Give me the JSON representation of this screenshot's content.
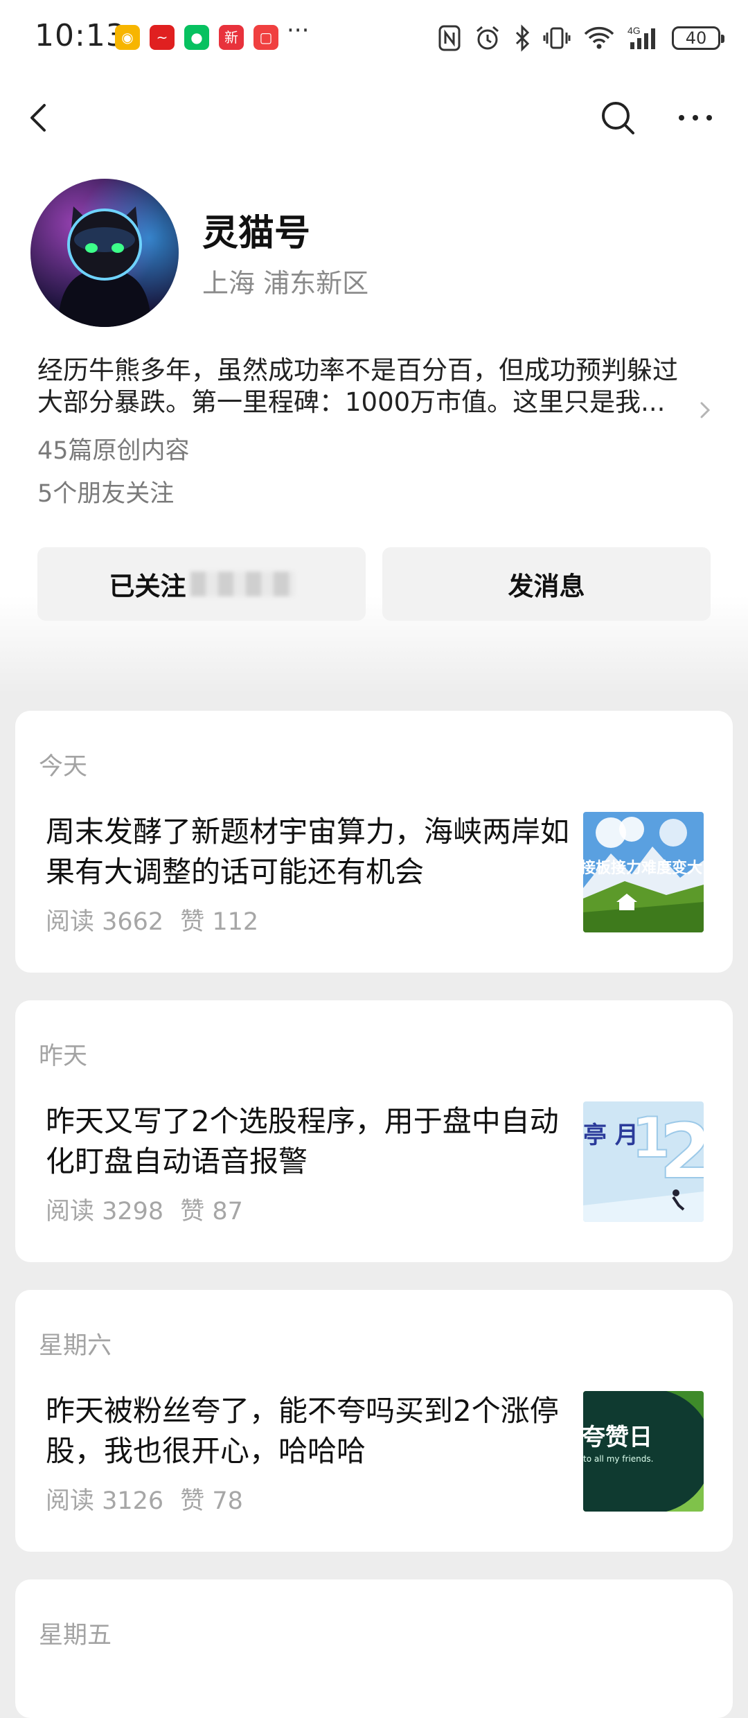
{
  "status_bar": {
    "time": "10:13",
    "app_icons": [
      {
        "icon": "weibo-icon",
        "color": "#f5a623"
      },
      {
        "icon": "finance-app-icon",
        "color": "#e02020"
      },
      {
        "icon": "wechat-icon",
        "color": "#07c160"
      },
      {
        "icon": "news-app-icon",
        "color": "#e8323c"
      },
      {
        "icon": "red-app-icon",
        "color": "#f04040"
      }
    ],
    "overflow": "···",
    "network": "4G",
    "battery": "40"
  },
  "profile": {
    "name": "灵猫号",
    "location": "上海 浦东新区",
    "bio_line1": "经历牛熊多年，虽然成功率不是百分百，但成功预判躲过",
    "bio_line2": "大部分暴跌。第一里程碑：1000万市值。这里只是我...",
    "articles_count": "45篇原创内容",
    "friends_following": "5个朋友关注"
  },
  "actions": {
    "follow_label": "已关注",
    "message_label": "发消息"
  },
  "articles": [
    {
      "day": "今天",
      "title": "周末发酵了新题材宇宙算力，海峡两岸如果有大调整的话可能还有机会",
      "reads": "阅读 3662",
      "likes": "赞 112",
      "thumb_text": "接板接力难度变大"
    },
    {
      "day": "昨天",
      "title": "昨天又写了2个选股程序，用于盘中自动化盯盘自动语音报警",
      "reads": "阅读 3298",
      "likes": "赞 87",
      "thumb_text": "亭 月"
    },
    {
      "day": "星期六",
      "title": "昨天被粉丝夸了，能不夸吗买到2个涨停股，我也很开心，哈哈哈",
      "reads": "阅读 3126",
      "likes": "赞 78",
      "thumb_text": "夸赞日",
      "thumb_subtext": "to all my friends."
    },
    {
      "day": "星期五"
    }
  ]
}
